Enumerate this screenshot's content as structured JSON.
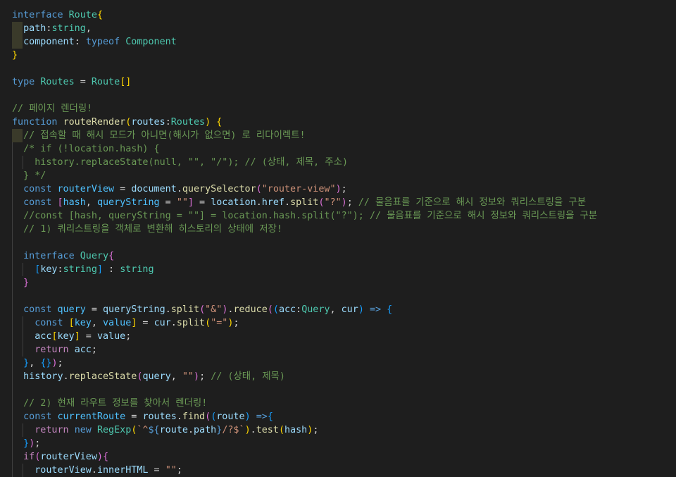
{
  "window": {
    "title": "",
    "background": "#1e1e1e"
  },
  "theme": {
    "keyword": "#569cd6",
    "control": "#c586c0",
    "type": "#4ec9b0",
    "function": "#dcdcaa",
    "variable": "#9cdcfe",
    "constant": "#4fc1ff",
    "string": "#ce9178",
    "comment": "#6a9955",
    "bracket_1": "#ffd700",
    "bracket_2": "#da70d6",
    "bracket_3": "#179fff"
  },
  "code_lines": [
    {
      "indent": 0,
      "tokens": [
        [
          "kw",
          "interface"
        ],
        [
          "p",
          " "
        ],
        [
          "type",
          "Route"
        ],
        [
          "b1",
          "{"
        ]
      ]
    },
    {
      "indent": 1,
      "hl": true,
      "tokens": [
        [
          "var",
          "path"
        ],
        [
          "p",
          ":"
        ],
        [
          "type",
          "string"
        ],
        [
          "p",
          ","
        ]
      ]
    },
    {
      "indent": 1,
      "hl": true,
      "tokens": [
        [
          "var",
          "component"
        ],
        [
          "p",
          ": "
        ],
        [
          "kw",
          "typeof"
        ],
        [
          "p",
          " "
        ],
        [
          "type",
          "Component"
        ]
      ]
    },
    {
      "indent": 0,
      "tokens": [
        [
          "b1",
          "}"
        ]
      ]
    },
    {
      "indent": 0,
      "tokens": []
    },
    {
      "indent": 0,
      "tokens": [
        [
          "kw",
          "type"
        ],
        [
          "p",
          " "
        ],
        [
          "type",
          "Routes"
        ],
        [
          "p",
          " = "
        ],
        [
          "type",
          "Route"
        ],
        [
          "b1",
          "[]"
        ]
      ]
    },
    {
      "indent": 0,
      "tokens": []
    },
    {
      "indent": 0,
      "tokens": [
        [
          "cmt",
          "// 페이지 렌더링!"
        ]
      ]
    },
    {
      "indent": 0,
      "tokens": [
        [
          "kw",
          "function"
        ],
        [
          "p",
          " "
        ],
        [
          "fn",
          "routeRender"
        ],
        [
          "b1",
          "("
        ],
        [
          "var",
          "routes"
        ],
        [
          "p",
          ":"
        ],
        [
          "type",
          "Routes"
        ],
        [
          "b1",
          ")"
        ],
        [
          "p",
          " "
        ],
        [
          "b1",
          "{"
        ]
      ]
    },
    {
      "indent": 1,
      "hl": true,
      "tokens": [
        [
          "cmt",
          "// 접속할 때 해시 모드가 아니면(해시가 없으면) 로 리다이렉트!"
        ]
      ]
    },
    {
      "indent": 1,
      "tokens": [
        [
          "cmt",
          "/* if (!location.hash) {"
        ]
      ]
    },
    {
      "indent": 2,
      "tokens": [
        [
          "cmt",
          "history.replaceState(null, \"\", \"/\"); // (상태, 제목, 주소)"
        ]
      ]
    },
    {
      "indent": 1,
      "tokens": [
        [
          "cmt",
          "} */"
        ]
      ]
    },
    {
      "indent": 1,
      "tokens": [
        [
          "kw",
          "const"
        ],
        [
          "p",
          " "
        ],
        [
          "const",
          "routerView"
        ],
        [
          "p",
          " = "
        ],
        [
          "var",
          "document"
        ],
        [
          "p",
          "."
        ],
        [
          "fn",
          "querySelector"
        ],
        [
          "b2",
          "("
        ],
        [
          "str",
          "\"router-view\""
        ],
        [
          "b2",
          ")"
        ],
        [
          "p",
          ";"
        ]
      ]
    },
    {
      "indent": 1,
      "tokens": [
        [
          "kw",
          "const"
        ],
        [
          "p",
          " "
        ],
        [
          "b2",
          "["
        ],
        [
          "const",
          "hash"
        ],
        [
          "p",
          ", "
        ],
        [
          "const",
          "queryString"
        ],
        [
          "p",
          " = "
        ],
        [
          "str",
          "\"\""
        ],
        [
          "b2",
          "]"
        ],
        [
          "p",
          " = "
        ],
        [
          "var",
          "location"
        ],
        [
          "p",
          "."
        ],
        [
          "var",
          "href"
        ],
        [
          "p",
          "."
        ],
        [
          "fn",
          "split"
        ],
        [
          "b2",
          "("
        ],
        [
          "str",
          "\"?\""
        ],
        [
          "b2",
          ")"
        ],
        [
          "p",
          "; "
        ],
        [
          "cmt",
          "// 물음표를 기준으로 해시 정보와 쿼리스트링을 구분"
        ]
      ]
    },
    {
      "indent": 1,
      "tokens": [
        [
          "cmt",
          "//const [hash, queryString = \"\"] = location.hash.split(\"?\"); // 물음표를 기준으로 해시 정보와 쿼리스트링을 구분"
        ]
      ]
    },
    {
      "indent": 1,
      "tokens": [
        [
          "cmt",
          "// 1) 쿼리스트링을 객체로 변환해 히스토리의 상태에 저장!"
        ]
      ]
    },
    {
      "indent": 1,
      "tokens": []
    },
    {
      "indent": 1,
      "tokens": [
        [
          "kw",
          "interface"
        ],
        [
          "p",
          " "
        ],
        [
          "type",
          "Query"
        ],
        [
          "b2",
          "{"
        ]
      ]
    },
    {
      "indent": 2,
      "tokens": [
        [
          "b3",
          "["
        ],
        [
          "var",
          "key"
        ],
        [
          "p",
          ":"
        ],
        [
          "type",
          "string"
        ],
        [
          "b3",
          "]"
        ],
        [
          "p",
          " : "
        ],
        [
          "type",
          "string"
        ]
      ]
    },
    {
      "indent": 1,
      "tokens": [
        [
          "b2",
          "}"
        ]
      ]
    },
    {
      "indent": 1,
      "tokens": []
    },
    {
      "indent": 1,
      "tokens": [
        [
          "kw",
          "const"
        ],
        [
          "p",
          " "
        ],
        [
          "const",
          "query"
        ],
        [
          "p",
          " = "
        ],
        [
          "var",
          "queryString"
        ],
        [
          "p",
          "."
        ],
        [
          "fn",
          "split"
        ],
        [
          "b2",
          "("
        ],
        [
          "str",
          "\"&\""
        ],
        [
          "b2",
          ")"
        ],
        [
          "p",
          "."
        ],
        [
          "fn",
          "reduce"
        ],
        [
          "b2",
          "("
        ],
        [
          "b3",
          "("
        ],
        [
          "var",
          "acc"
        ],
        [
          "p",
          ":"
        ],
        [
          "type",
          "Query"
        ],
        [
          "p",
          ", "
        ],
        [
          "var",
          "cur"
        ],
        [
          "b3",
          ")"
        ],
        [
          "p",
          " "
        ],
        [
          "kw",
          "=>"
        ],
        [
          "p",
          " "
        ],
        [
          "b3",
          "{"
        ]
      ]
    },
    {
      "indent": 2,
      "tokens": [
        [
          "kw",
          "const"
        ],
        [
          "p",
          " "
        ],
        [
          "b1",
          "["
        ],
        [
          "const",
          "key"
        ],
        [
          "p",
          ", "
        ],
        [
          "const",
          "value"
        ],
        [
          "b1",
          "]"
        ],
        [
          "p",
          " = "
        ],
        [
          "var",
          "cur"
        ],
        [
          "p",
          "."
        ],
        [
          "fn",
          "split"
        ],
        [
          "b1",
          "("
        ],
        [
          "str",
          "\"=\""
        ],
        [
          "b1",
          ")"
        ],
        [
          "p",
          ";"
        ]
      ]
    },
    {
      "indent": 2,
      "tokens": [
        [
          "var",
          "acc"
        ],
        [
          "b1",
          "["
        ],
        [
          "var",
          "key"
        ],
        [
          "b1",
          "]"
        ],
        [
          "p",
          " = "
        ],
        [
          "var",
          "value"
        ],
        [
          "p",
          ";"
        ]
      ]
    },
    {
      "indent": 2,
      "tokens": [
        [
          "ctl",
          "return"
        ],
        [
          "p",
          " "
        ],
        [
          "var",
          "acc"
        ],
        [
          "p",
          ";"
        ]
      ]
    },
    {
      "indent": 1,
      "tokens": [
        [
          "b3",
          "}"
        ],
        [
          "p",
          ", "
        ],
        [
          "b3",
          "{}"
        ],
        [
          "b2",
          ")"
        ],
        [
          "p",
          ";"
        ]
      ]
    },
    {
      "indent": 1,
      "tokens": [
        [
          "var",
          "history"
        ],
        [
          "p",
          "."
        ],
        [
          "fn",
          "replaceState"
        ],
        [
          "b2",
          "("
        ],
        [
          "var",
          "query"
        ],
        [
          "p",
          ", "
        ],
        [
          "str",
          "\"\""
        ],
        [
          "b2",
          ")"
        ],
        [
          "p",
          "; "
        ],
        [
          "cmt",
          "// (상태, 제목)"
        ]
      ]
    },
    {
      "indent": 1,
      "tokens": []
    },
    {
      "indent": 1,
      "tokens": [
        [
          "cmt",
          "// 2) 현재 라우트 정보를 찾아서 렌더링!"
        ]
      ]
    },
    {
      "indent": 1,
      "tokens": [
        [
          "kw",
          "const"
        ],
        [
          "p",
          " "
        ],
        [
          "const",
          "currentRoute"
        ],
        [
          "p",
          " = "
        ],
        [
          "var",
          "routes"
        ],
        [
          "p",
          "."
        ],
        [
          "fn",
          "find"
        ],
        [
          "b2",
          "("
        ],
        [
          "b3",
          "("
        ],
        [
          "var",
          "route"
        ],
        [
          "b3",
          ")"
        ],
        [
          "p",
          " "
        ],
        [
          "kw",
          "=>"
        ],
        [
          "b3",
          "{"
        ]
      ]
    },
    {
      "indent": 2,
      "tokens": [
        [
          "ctl",
          "return"
        ],
        [
          "p",
          " "
        ],
        [
          "kw",
          "new"
        ],
        [
          "p",
          " "
        ],
        [
          "type",
          "RegExp"
        ],
        [
          "b1",
          "("
        ],
        [
          "str",
          "`^"
        ],
        [
          "kw",
          "${"
        ],
        [
          "var",
          "route"
        ],
        [
          "p",
          "."
        ],
        [
          "var",
          "path"
        ],
        [
          "kw",
          "}"
        ],
        [
          "str",
          "/?$`"
        ],
        [
          "b1",
          ")"
        ],
        [
          "p",
          "."
        ],
        [
          "fn",
          "test"
        ],
        [
          "b1",
          "("
        ],
        [
          "var",
          "hash"
        ],
        [
          "b1",
          ")"
        ],
        [
          "p",
          ";"
        ]
      ]
    },
    {
      "indent": 1,
      "tokens": [
        [
          "b3",
          "}"
        ],
        [
          "b2",
          ")"
        ],
        [
          "p",
          ";"
        ]
      ]
    },
    {
      "indent": 1,
      "tokens": [
        [
          "ctl",
          "if"
        ],
        [
          "b2",
          "("
        ],
        [
          "var",
          "routerView"
        ],
        [
          "b2",
          ")"
        ],
        [
          "b2",
          "{"
        ]
      ]
    },
    {
      "indent": 2,
      "tokens": [
        [
          "var",
          "routerView"
        ],
        [
          "p",
          "."
        ],
        [
          "var",
          "innerHTML"
        ],
        [
          "p",
          " = "
        ],
        [
          "str",
          "\"\""
        ],
        [
          "p",
          ";"
        ]
      ]
    }
  ]
}
